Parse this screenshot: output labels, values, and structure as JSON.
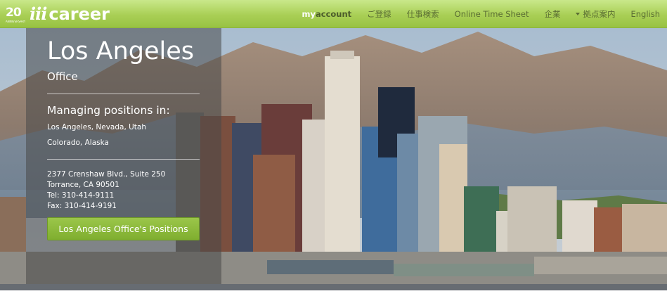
{
  "logo": {
    "anniversary": "20",
    "anniversary_sub": "ANNIVERSARY",
    "brand_prefix": "iii",
    "brand_name": "career"
  },
  "nav": {
    "myaccount_my": "my",
    "myaccount_account": "account",
    "register": "ご登録",
    "job_search": "仕事検索",
    "timesheet": "Online Time Sheet",
    "company": "企業",
    "locations": "拠点案内",
    "language": "English"
  },
  "office": {
    "city": "Los Angeles",
    "label": "Office",
    "managing_title": "Managing positions in:",
    "managing_line1": "Los Angeles, Nevada, Utah",
    "managing_line2": "Colorado, Alaska",
    "address1": "2377 Crenshaw Blvd., Suite 250",
    "address2": "Torrance, CA 90501",
    "tel": "Tel: 310-414-9111",
    "fax": "Fax: 310-414-9191",
    "positions_button": "Los Angeles Office's Positions"
  },
  "colors": {
    "nav_green": "#a9cf55",
    "button_green": "#8cba3c",
    "panel_overlay": "rgba(72,72,72,0.55)"
  }
}
